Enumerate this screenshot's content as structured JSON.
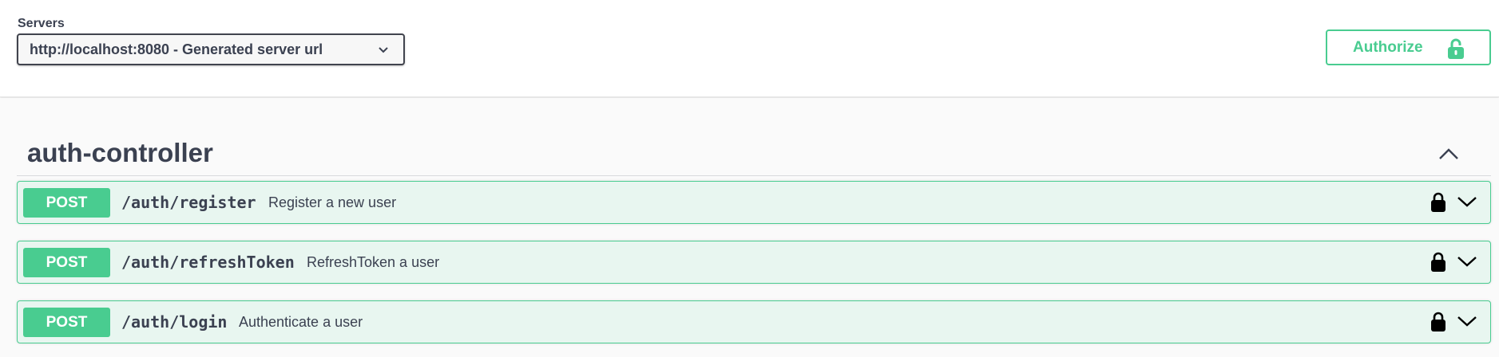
{
  "header": {
    "servers_label": "Servers",
    "server_selected": "http://localhost:8080 - Generated server url",
    "authorize_label": "Authorize"
  },
  "tag": {
    "title": "auth-controller"
  },
  "operations": [
    {
      "method": "POST",
      "path": "/auth/register",
      "summary": "Register a new user"
    },
    {
      "method": "POST",
      "path": "/auth/refreshToken",
      "summary": "RefreshToken a user"
    },
    {
      "method": "POST",
      "path": "/auth/login",
      "summary": "Authenticate a user"
    }
  ],
  "icons": {
    "server_dropdown": "chevron-down-icon",
    "authorize": "unlocked-lock-icon",
    "tag_toggle": "chevron-up-icon",
    "operation_lock": "lock-icon",
    "operation_toggle": "chevron-down-icon"
  },
  "colors": {
    "post_accent": "#49cc90",
    "post_background": "#e8f6f0",
    "text": "#3b4151"
  }
}
